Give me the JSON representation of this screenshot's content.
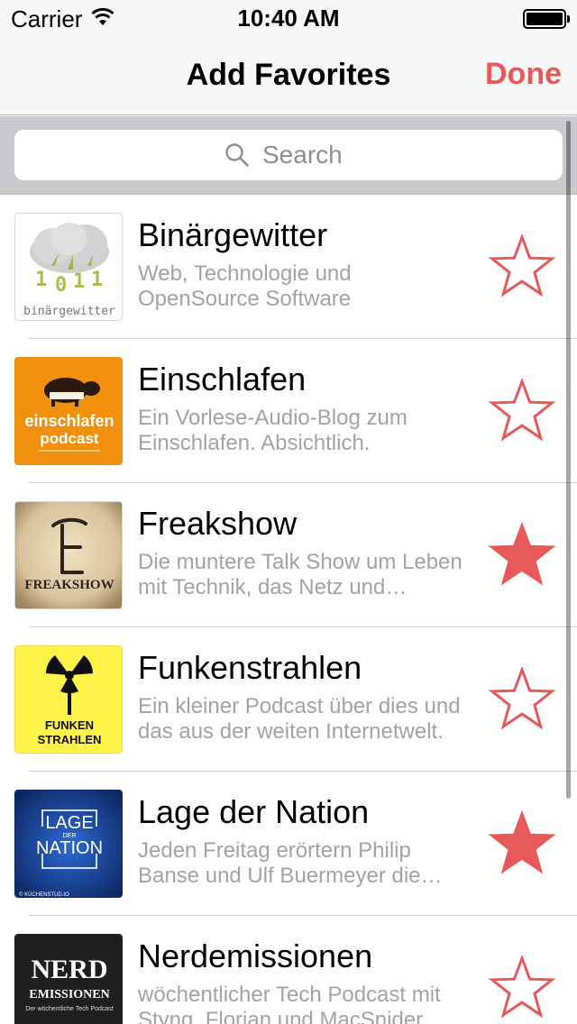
{
  "status_bar": {
    "carrier": "Carrier",
    "time": "10:40 AM"
  },
  "nav": {
    "title": "Add Favorites",
    "done_label": "Done",
    "accent_color": "#e85a5a"
  },
  "search": {
    "placeholder": "Search",
    "value": ""
  },
  "podcasts": [
    {
      "title": "Binärgewitter",
      "description": "Web, Technologie und OpenSource Software",
      "favorite": false,
      "artwork_text": "binärgewitter"
    },
    {
      "title": "Einschlafen",
      "description": "Ein Vorlese-Audio-Blog zum Einschlafen. Absichtlich.",
      "favorite": false,
      "artwork_text": "einschlafen",
      "artwork_text2": "podcast"
    },
    {
      "title": "Freakshow",
      "description": "Die muntere Talk Show um Leben mit Technik, das Netz und Technikkultur.",
      "favorite": true,
      "artwork_text": "FREAKSHOW"
    },
    {
      "title": "Funkenstrahlen",
      "description": "Ein kleiner Podcast über dies und das aus der weiten Internetwelt.",
      "favorite": false,
      "artwork_text": "FUNKEN",
      "artwork_text2": "STRAHLEN"
    },
    {
      "title": "Lage der Nation",
      "description": "Jeden Freitag erörtern Philip Banse und Ulf Buermeyer die wichtigsten Themen der Woche.",
      "favorite": true,
      "artwork_text": "LAGE",
      "artwork_text2": "DER",
      "artwork_text3": "NATION",
      "artwork_text4": "© KÜCHENSTUD.IO"
    },
    {
      "title": "Nerdemissionen",
      "description": "wöchentlicher Tech Podcast mit Styng, Florian und MacSnider",
      "favorite": false,
      "artwork_text": "NERD",
      "artwork_text2": "EMISSIONEN",
      "artwork_text3": "Der wöchentliche Tech Podcast"
    }
  ]
}
